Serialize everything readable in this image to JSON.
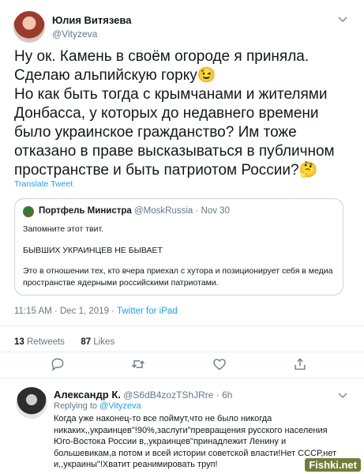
{
  "tweet": {
    "author_name": "Юлия Витязева",
    "author_handle": "@Vityzeva",
    "text": "Ну ок. Камень в своём огороде я приняла. Сделаю альпийскую горку😉\nНо как быть тогда с крымчанами и жителями Донбасса, у которых до недавнего времени было украинское гражданство? Им тоже отказано в праве высказываться в публичном пространстве и быть патриотом России?🤔",
    "translate_label": "Translate Tweet",
    "quoted": {
      "author_name": "Портфель Министра",
      "author_handle": "@MoskRussia",
      "date": "· Nov 30",
      "line1": "Запомните этот твит.",
      "line2": "БЫВШИХ УКРАИНЦЕВ НЕ БЫВАЕТ",
      "line3": "Это в отношении тех, кто вчера приехал с хутора и позиционирует себя в медиа пространстве ядерными российскими патриотами."
    },
    "timestamp": "11:15 AM · Dec 1, 2019 ·",
    "source": "Twitter for iPad",
    "retweets_count": "13",
    "retweets_label": "Retweets",
    "likes_count": "87",
    "likes_label": "Likes"
  },
  "actions": {
    "icons": [
      "reply-icon",
      "retweet-icon",
      "like-icon",
      "share-icon"
    ]
  },
  "reply": {
    "author_name": "Александр К.",
    "author_handle": "@S6dB4zozTShJRre",
    "time": "· 6h",
    "replying_prefix": "Replying to",
    "replying_handle": "@Vityzeva",
    "text": "Когда уже наконец-то все поймут,что не было никогда никаких,,украинцев\"!90%,заслуги\"превращения русского населения Юго-Востока России в,,украинцев\"принадлежит Ленину и большевикам,а потом и всей истории советской власти!Нет СССР,нет и,,украины\"!Хватит реанимировать труп!"
  },
  "watermark": "Fishki.net",
  "colors": {
    "accent": "#1da1f2",
    "muted": "#657786",
    "border": "#ccd6dd"
  }
}
